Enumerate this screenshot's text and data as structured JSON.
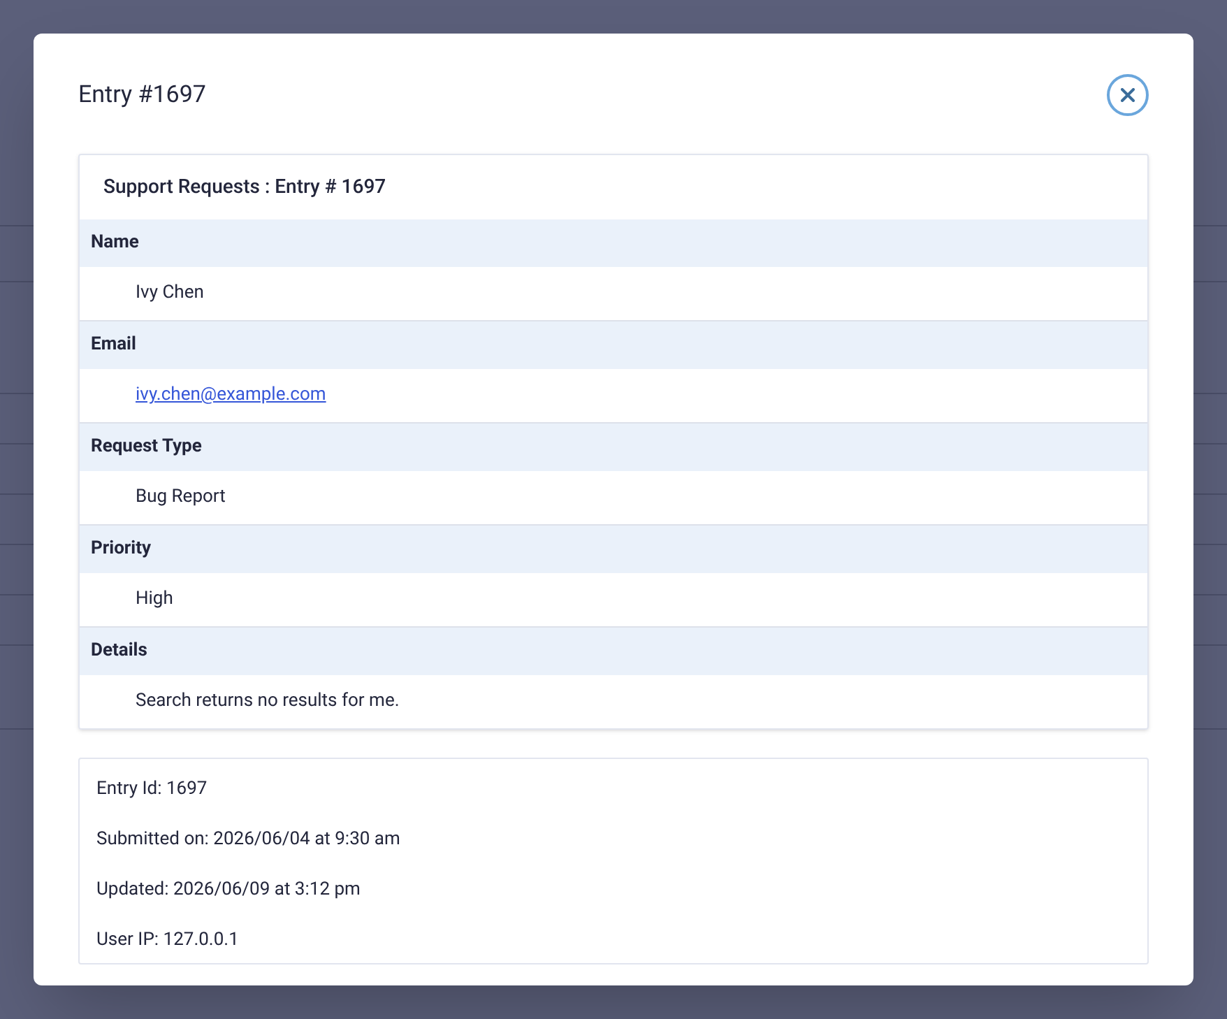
{
  "modal": {
    "title": "Entry #1697",
    "form_card": {
      "title": "Support Requests : Entry # 1697",
      "fields": [
        {
          "label": "Name",
          "value": "Ivy Chen",
          "kind": "text"
        },
        {
          "label": "Email",
          "value": "ivy.chen@example.com",
          "kind": "link"
        },
        {
          "label": "Request Type",
          "value": "Bug Report",
          "kind": "text"
        },
        {
          "label": "Priority",
          "value": "High",
          "kind": "text"
        },
        {
          "label": "Details",
          "value": "Search returns no results for me.",
          "kind": "text"
        }
      ]
    },
    "meta_card": {
      "lines": [
        {
          "label": "Entry Id: 1697"
        },
        {
          "label": "Submitted on: 2026/06/04 at 9:30 am"
        },
        {
          "label": "Updated: 2026/06/09 at 3:12 pm"
        },
        {
          "label": "User IP: 127.0.0.1"
        }
      ]
    }
  }
}
